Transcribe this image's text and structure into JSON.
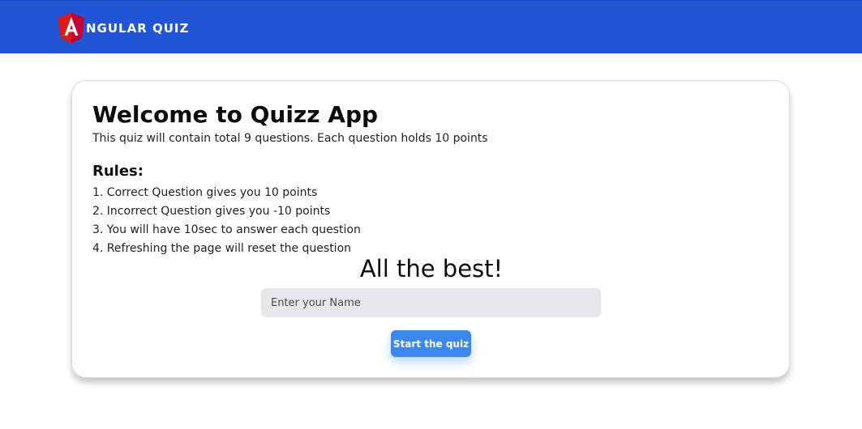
{
  "navbar": {
    "brand_text": "NGULAR QUIZ",
    "logo_icon": "angular-logo-icon",
    "colors": {
      "background": "#2255d6",
      "logo_red": "#dd1b16"
    }
  },
  "card": {
    "title": "Welcome to Quizz App",
    "subtitle": "This quiz will contain total 9 questions. Each question holds 10 points",
    "rules_heading": "Rules:",
    "rules": [
      "1. Correct Question gives you 10 points",
      "2. Incorrect Question gives you -10 points",
      "3. You will have 10sec to answer each question",
      "4. Refreshing the page will reset the question"
    ],
    "closing_text": "All the best!",
    "name_input": {
      "placeholder": "Enter your Name",
      "value": ""
    },
    "start_button_label": "Start the quiz",
    "colors": {
      "button": "#3d87f0",
      "input_bg": "#e6e7ea"
    }
  }
}
